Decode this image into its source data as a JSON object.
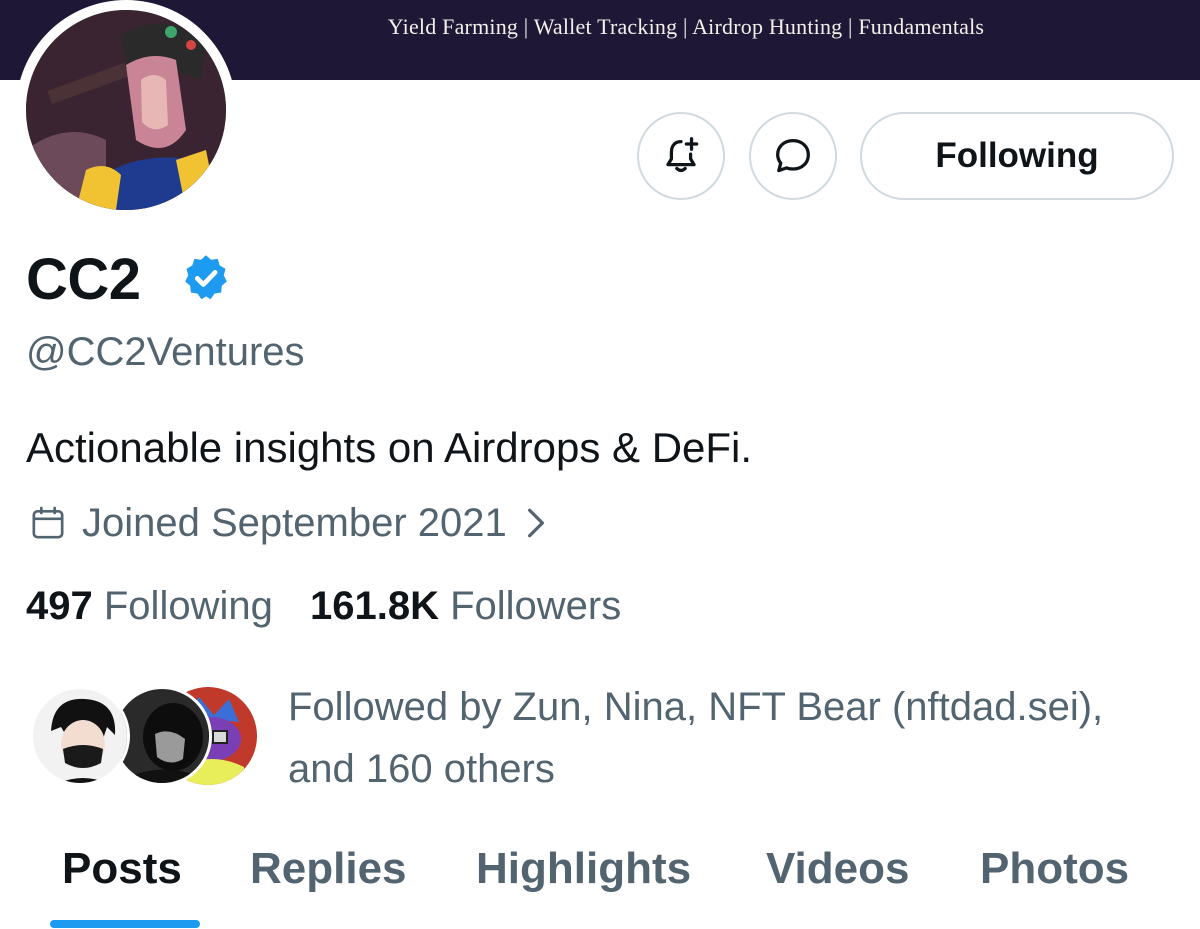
{
  "banner": {
    "tagline": "Yield Farming | Wallet Tracking | Airdrop Hunting | Fundamentals"
  },
  "actions": {
    "notify_icon": "bell-plus-icon",
    "message_icon": "message-bubble-icon",
    "follow_label": "Following"
  },
  "profile": {
    "display_name": "CC2",
    "verified": true,
    "handle": "@CC2Ventures",
    "bio": "Actionable insights on Airdrops & DeFi.",
    "joined": "Joined September 2021"
  },
  "stats": {
    "following_count": "497",
    "following_label": "Following",
    "followers_count": "161.8K",
    "followers_label": "Followers"
  },
  "followed_by": {
    "text": "Followed by Zun, Nina, NFT Bear (nftdad.sei), and 160 others"
  },
  "tabs": [
    {
      "label": "Posts",
      "active": true
    },
    {
      "label": "Replies",
      "active": false
    },
    {
      "label": "Highlights",
      "active": false
    },
    {
      "label": "Videos",
      "active": false
    },
    {
      "label": "Photos",
      "active": false
    }
  ],
  "colors": {
    "accent": "#1d9bf0",
    "banner_bg": "#1f1736",
    "text_primary": "#0f1419",
    "text_secondary": "#536471"
  }
}
